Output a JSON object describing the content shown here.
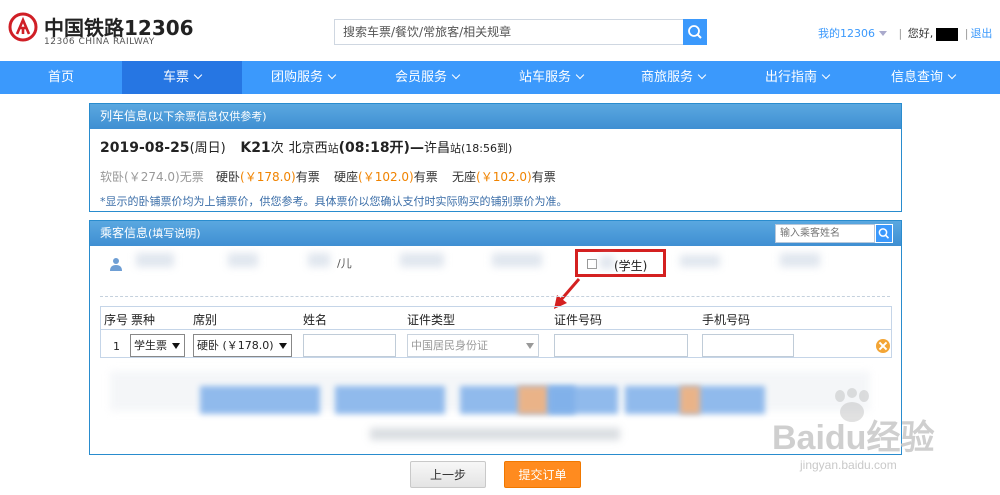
{
  "header": {
    "logo_cn": "中国铁路12306",
    "logo_en": "12306 CHINA RAILWAY",
    "search_placeholder": "搜索车票/餐饮/常旅客/相关规章",
    "my12306": "我的12306",
    "greeting": "您好,",
    "logout": "退出"
  },
  "nav": {
    "items": [
      {
        "label": "首页"
      },
      {
        "label": "车票"
      },
      {
        "label": "团购服务"
      },
      {
        "label": "会员服务"
      },
      {
        "label": "站车服务"
      },
      {
        "label": "商旅服务"
      },
      {
        "label": "出行指南"
      },
      {
        "label": "信息查询"
      }
    ]
  },
  "train_panel": {
    "title": "列车信息",
    "subtitle": "(以下余票信息仅供参考)",
    "date": "2019-08-25",
    "weekday": "(周日)",
    "train_no": "K21",
    "train_suffix": "次",
    "from_station": "北京西",
    "from_suffix": "站",
    "depart": "(08:18开)",
    "dash": "—",
    "to_station": "许昌",
    "to_suffix": "站",
    "arrive": "(18:56到)",
    "seats": [
      {
        "type": "软卧",
        "price": "(￥274.0)",
        "status": "无票"
      },
      {
        "type": "硬卧",
        "price": "(￥178.0)",
        "status": "有票"
      },
      {
        "type": "硬座",
        "price": "(￥102.0)",
        "status": "有票"
      },
      {
        "type": "无座",
        "price": "(￥102.0)",
        "status": "有票"
      }
    ],
    "note": "*显示的卧铺票价均为上铺票价，供您参考。具体票价以您确认支付时实际购买的铺别票价为准。"
  },
  "passenger_panel": {
    "title": "乘客信息",
    "subtitle": "(填写说明)",
    "search_placeholder": "输入乘客姓名",
    "student_label": "(学生)",
    "partial_label": "/儿",
    "table": {
      "headers": [
        "序号",
        "票种",
        "席别",
        "姓名",
        "证件类型",
        "证件号码",
        "手机号码"
      ],
      "row": {
        "num": "1",
        "ticket_type": "学生票",
        "seat": "硬卧 (￥178.0)",
        "id_type": "中国居民身份证"
      }
    }
  },
  "buttons": {
    "prev": "上一步",
    "submit": "提交订单"
  },
  "watermark": {
    "text": "Baidu经验",
    "sub": "jingyan.baidu.com"
  }
}
